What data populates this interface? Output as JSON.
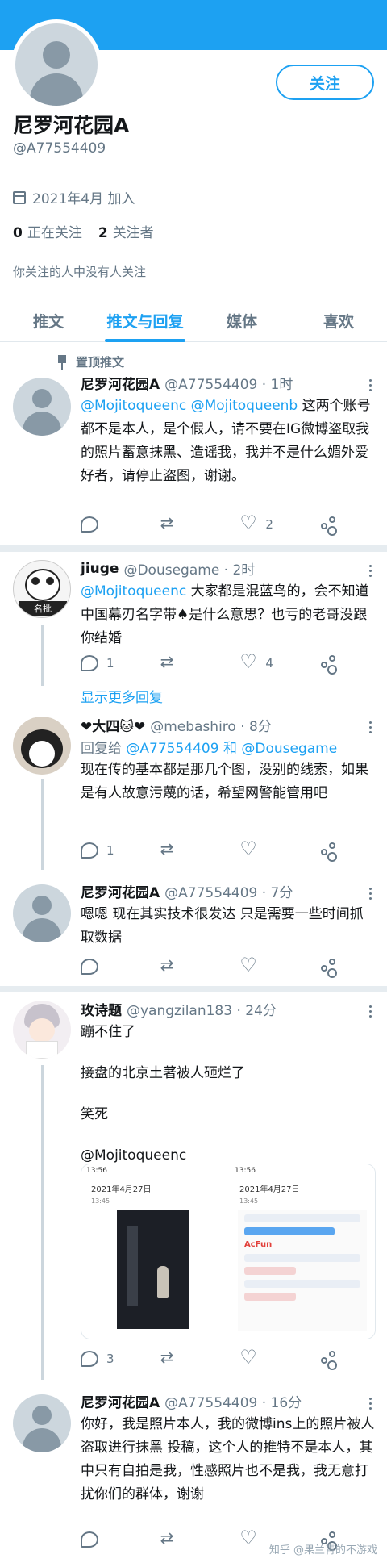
{
  "profile": {
    "display_name": "尼罗河花园A",
    "handle": "@A77554409",
    "follow_button": "关注",
    "joined": "2021年4月 加入",
    "following_count": "0",
    "following_label": "正在关注",
    "followers_count": "2",
    "followers_label": "关注者",
    "mutual_note": "你关注的人中没有人关注"
  },
  "tabs": [
    "推文",
    "推文与回复",
    "媒体",
    "喜欢"
  ],
  "active_tab": "推文与回复",
  "pinned_label": "置顶推文",
  "show_more_replies": "显示更多回复",
  "tweets": [
    {
      "name": "尼罗河花园A",
      "meta": "@A77554409 · 1时",
      "mentions": "@Mojitoqueenc @Mojitoqueenb",
      "text": "这两个账号都不是本人，是个假人，请不要在IG微博盗取我的照片蓄意抹黑、造谣我，我并不是什么媚外爱好者，请停止盗图，谢谢。",
      "reply_count": "",
      "retweet_count": "",
      "like_count": "2"
    },
    {
      "name": "jiuge",
      "meta": "@Dousegame · 2时",
      "mentions": "@Mojitoqueenc",
      "text": "大家都是混蓝鸟的，会不知道中国幕刃名字带♠是什么意思？也亏的老哥没跟你结婚",
      "avatar_caption": "名批",
      "reply_count": "1",
      "retweet_count": "",
      "like_count": "4"
    },
    {
      "name": "❤大四🐱❤",
      "meta": "@mebashiro · 8分",
      "reply_prefix": "回复给",
      "reply_targets": "@A77554409 和 @Dousegame",
      "text": "现在传的基本都是那几个图，没别的线索，如果是有人故意污蔑的话，希望网警能管用吧",
      "reply_count": "1",
      "retweet_count": "",
      "like_count": ""
    },
    {
      "name": "尼罗河花园A",
      "meta": "@A77554409 · 7分",
      "text": "嗯嗯 现在其实技术很发达 只是需要一些时间抓取数据",
      "reply_count": "",
      "retweet_count": "",
      "like_count": ""
    },
    {
      "name": "玫诗题",
      "meta": "@yangzilan183 · 24分",
      "line1": "蹦不住了",
      "line2": "接盘的北京土著被人砸烂了",
      "line3": "笑死",
      "mentions": "@Mojitoqueenc",
      "reply_count": "3",
      "retweet_count": "",
      "like_count": ""
    },
    {
      "name": "尼罗河花园A",
      "meta": "@A77554409 · 16分",
      "text": "你好，我是照片本人，我的微博ins上的照片被人盗取进行抹黑 投稿，这个人的推特不是本人，其中只有自拍是我，性感照片也不是我，我无意打扰你们的群体，谢谢",
      "reply_count": "",
      "retweet_count": "",
      "like_count": ""
    }
  ],
  "screenshots": {
    "status_time": "13:56",
    "date": "2021年4月27日",
    "time": "13:45",
    "acfun": "AcFun"
  },
  "watermark": "知乎 @果兰青的不游戏",
  "colors": {
    "accent": "#1da1f2",
    "muted": "#657786",
    "banner": "#1da1f2"
  }
}
